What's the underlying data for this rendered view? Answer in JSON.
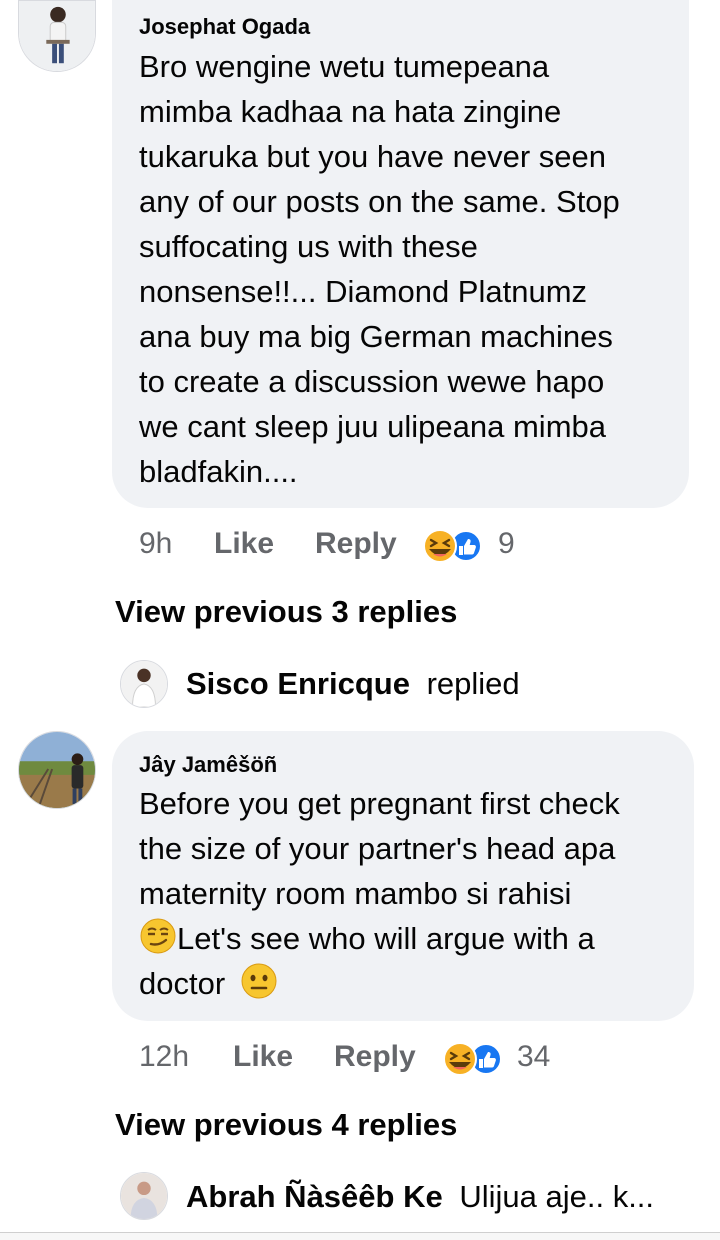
{
  "comments": [
    {
      "author": "Josephat Ogada",
      "lines": [
        "Bro wengine wetu tumepeana",
        "mimba kadhaa na hata zingine",
        "tukaruka but you have never seen",
        "any of our posts on the same. Stop",
        "suffocating us with these",
        "nonsense!!... Diamond Platnumz",
        "ana buy ma big German machines",
        "to create a discussion wewe hapo",
        "we cant sleep juu ulipeana mimba",
        "bladfakin...."
      ],
      "time": "9h",
      "like_label": "Like",
      "reply_label": "Reply",
      "reaction_count": "9",
      "reaction_icons": [
        "haha-icon",
        "like-icon"
      ],
      "view_previous": "View previous 3 replies",
      "latest_reply": {
        "name": "Sisco Enricque",
        "text": "replied"
      }
    },
    {
      "author": "Jây Jamêšöñ",
      "lines": [
        "Before you get pregnant first check",
        "the size of your partner's head apa",
        "maternity room mambo si rahisi",
        "Let's see who will argue with a",
        "doctor"
      ],
      "time": "12h",
      "like_label": "Like",
      "reply_label": "Reply",
      "reaction_count": "34",
      "reaction_icons": [
        "haha-icon",
        "like-icon"
      ],
      "view_previous": "View previous 4 replies",
      "latest_reply": {
        "name": "Abrah Ñàsêêb Ke",
        "text": "Ulijua aje.. k..."
      }
    }
  ],
  "colors": {
    "bubble": "#f0f2f5",
    "meta_text": "#65676b",
    "like_blue": "#1877f2",
    "haha_yellow": "#f7b125"
  }
}
